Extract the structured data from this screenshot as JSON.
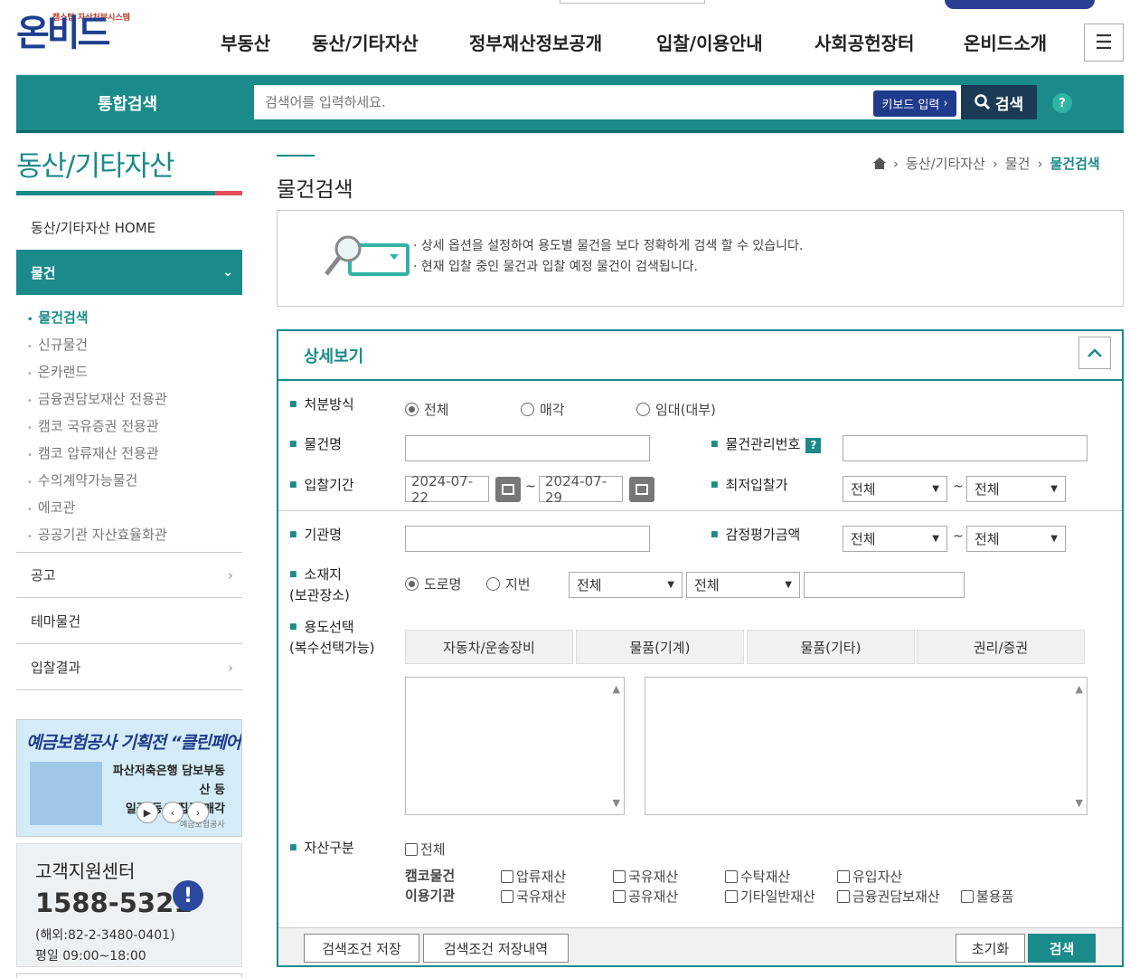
{
  "header": {
    "logo_text": "온비드",
    "logo_sub": "캠스탑 자산처분시스템",
    "nav": [
      "부동산",
      "동산/기타자산",
      "정부재산정보공개",
      "입찰/이용안내",
      "사회공헌장터",
      "온비드소개"
    ]
  },
  "search": {
    "title": "통합검색",
    "placeholder": "검색어를 입력하세요.",
    "keyboard_label": "키보드 입력",
    "button_label": "검색",
    "help_label": "?"
  },
  "sidebar": {
    "title": "동산/기타자산",
    "home": "동산/기타자산 HOME",
    "active": "물건",
    "sub_items": [
      "물건검색",
      "신규물건",
      "온카랜드",
      "금융권담보재산 전용관",
      "캠코 국유증권 전용관",
      "캠코 압류재산 전용관",
      "수의계약가능물건",
      "에코관",
      "공공기관 자산효율화관"
    ],
    "groups": [
      "공고",
      "테마물건",
      "입찰결과"
    ]
  },
  "banner": {
    "title": "예금보험공사 기획전 “클린페어”",
    "line1": "파산저축은행 담보부동산 등",
    "line2": "일괄·동시·집중 매각",
    "line3": "예금보험공사"
  },
  "customer": {
    "title": "고객지원센터",
    "phone": "1588-5321",
    "abroad": "(해외:82-2-3480-0401)",
    "hours": "평일 09:00~18:00"
  },
  "page": {
    "title": "물건검색",
    "breadcrumb": [
      "동산/기타자산",
      "물건",
      "물건검색"
    ],
    "info": [
      "상세 옵션을 설정하여 용도별 물건을 보다 정확하게 검색 할 수 있습니다.",
      "현재 입찰 중인 물건과 입찰 예정 물건이 검색됩니다."
    ]
  },
  "detail": {
    "title": "상세보기",
    "disposal_label": "처분방식",
    "disposal_options": [
      "전체",
      "매각",
      "임대(대부)"
    ],
    "name_label": "물건명",
    "mgmt_label": "물건관리번호",
    "period_label": "입찰기간",
    "date_from": "2024-07-22",
    "date_to": "2024-07-29",
    "tilde": "~",
    "min_price_label": "최저입찰가",
    "all": "전체",
    "org_label": "기관명",
    "appraisal_label": "감정평가금액",
    "location_label_1": "소재지",
    "location_label_2": "(보관장소)",
    "location_options": [
      "도로명",
      "지번"
    ],
    "usage_label_1": "용도선택",
    "usage_label_2": "(복수선택가능)",
    "usage_tabs": [
      "자동차/운송장비",
      "물품(기계)",
      "물품(기타)",
      "권리/증권"
    ],
    "asset_label": "자산구분",
    "asset_all": "전체",
    "kamco_label": "캠코물건",
    "kamco_items": [
      "압류재산",
      "국유재산",
      "수탁재산",
      "유입자산"
    ],
    "agency_label": "이용기관",
    "agency_items": [
      "국유재산",
      "공유재산",
      "기타일반재산",
      "금융권담보재산",
      "불용품"
    ]
  },
  "footer": {
    "save": "검색조건 저장",
    "history": "검색조건 저장내역",
    "reset": "초기화",
    "search": "검색"
  },
  "colors": {
    "accent": "#1a8a8a",
    "brand": "#1c3f8f",
    "alert": "#e24d5c"
  }
}
